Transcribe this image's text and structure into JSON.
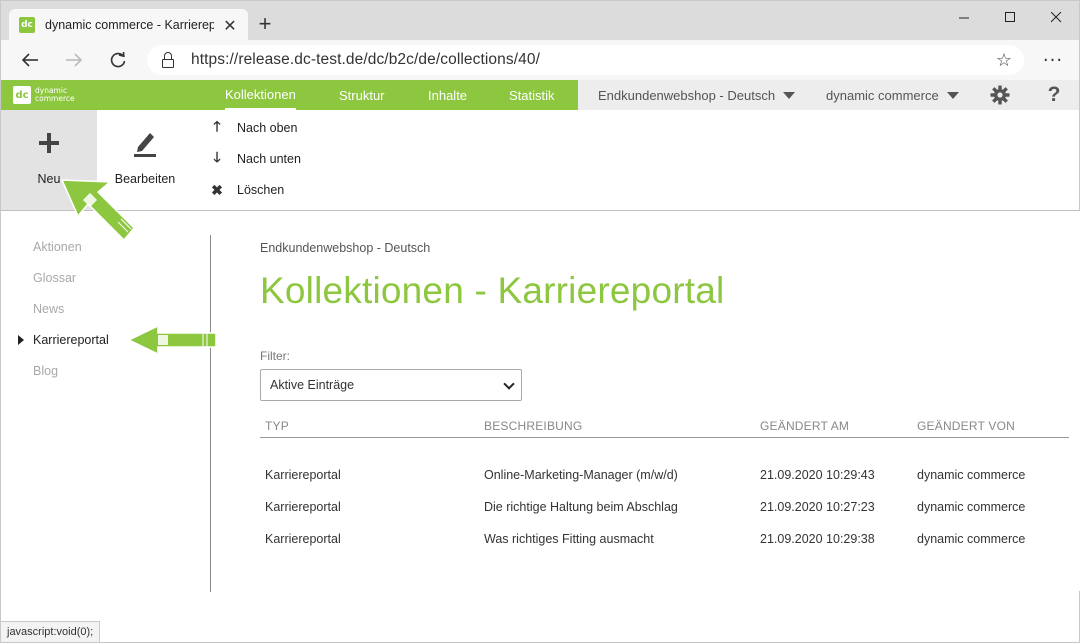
{
  "browser": {
    "tab_title": "dynamic commerce - Karrierepor",
    "tab_favicon": "dc",
    "url": "https://release.dc-test.de/dc/b2c/de/collections/40/",
    "status_text": "javascript:void(0);"
  },
  "brand": {
    "line1": "dynamic",
    "line2": "commerce",
    "mark": "dc",
    "color": "#8dc63f"
  },
  "nav": {
    "items": [
      {
        "label": "Kollektionen",
        "active": true
      },
      {
        "label": "Struktur",
        "active": false
      },
      {
        "label": "Inhalte",
        "active": false
      },
      {
        "label": "Statistik",
        "active": false
      }
    ],
    "shop_select": "Endkundenwebshop - Deutsch",
    "user_select": "dynamic commerce",
    "settings_icon": "gear-icon",
    "help_icon": "help-icon"
  },
  "toolbar": {
    "new_label": "Neu",
    "edit_label": "Bearbeiten",
    "up_label": "Nach oben",
    "down_label": "Nach unten",
    "delete_label": "Löschen"
  },
  "sidebar": {
    "items": [
      {
        "label": "Aktionen",
        "active": false
      },
      {
        "label": "Glossar",
        "active": false
      },
      {
        "label": "News",
        "active": false
      },
      {
        "label": "Karriereportal",
        "active": true
      },
      {
        "label": "Blog",
        "active": false
      }
    ]
  },
  "main": {
    "breadcrumb": "Endkundenwebshop - Deutsch",
    "title": "Kollektionen - Karriereportal",
    "filter_label": "Filter:",
    "filter_value": "Aktive Einträge",
    "columns": [
      "TYP",
      "BESCHREIBUNG",
      "GEÄNDERT AM",
      "GEÄNDERT VON"
    ],
    "rows": [
      [
        "Karriereportal",
        "Online-Marketing-Manager (m/w/d)",
        "21.09.2020 10:29:43",
        "dynamic commerce"
      ],
      [
        "Karriereportal",
        "Die richtige Haltung beim Abschlag",
        "21.09.2020 10:27:23",
        "dynamic commerce"
      ],
      [
        "Karriereportal",
        "Was richtiges Fitting ausmacht",
        "21.09.2020 10:29:38",
        "dynamic commerce"
      ]
    ]
  }
}
